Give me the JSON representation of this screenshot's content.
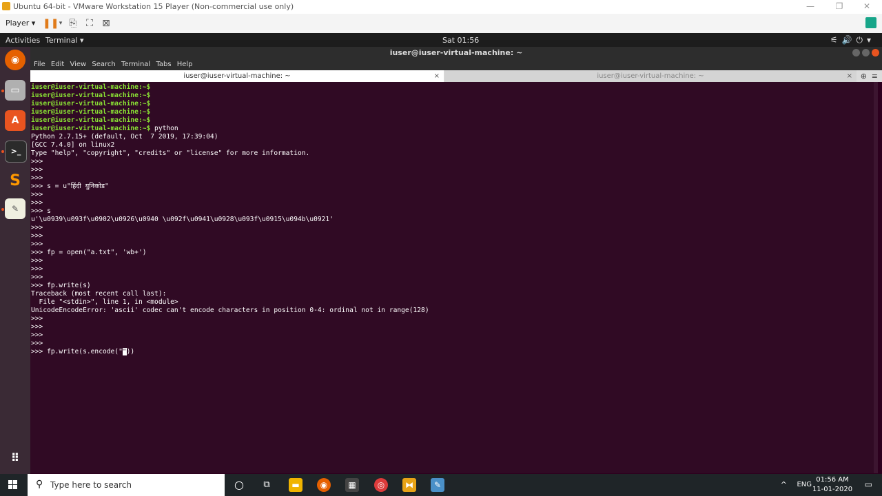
{
  "vmware": {
    "title": "Ubuntu 64-bit - VMware Workstation 15 Player (Non-commercial use only)",
    "player_menu": "Player ▾",
    "window_controls": [
      "—",
      "❐",
      "✕"
    ]
  },
  "ubuntu_topbar": {
    "activities": "Activities",
    "app_menu": "Terminal ▾",
    "clock": "Sat 01:56",
    "system_icons": "⚟🔊⏻▾"
  },
  "terminal": {
    "window_title": "iuser@iuser-virtual-machine: ~",
    "menu": [
      "File",
      "Edit",
      "View",
      "Search",
      "Terminal",
      "Tabs",
      "Help"
    ],
    "tabs": [
      {
        "label": "iuser@iuser-virtual-machine: ~",
        "active": true
      },
      {
        "label": "iuser@iuser-virtual-machine: ~",
        "active": false
      }
    ],
    "prompt": "iuser@iuser-virtual-machine:~$",
    "lines": [
      {
        "prompt": true,
        "text": ""
      },
      {
        "prompt": true,
        "text": ""
      },
      {
        "prompt": true,
        "text": ""
      },
      {
        "prompt": true,
        "text": ""
      },
      {
        "prompt": true,
        "text": ""
      },
      {
        "prompt": true,
        "text": " python"
      },
      {
        "prompt": false,
        "text": "Python 2.7.15+ (default, Oct  7 2019, 17:39:04)"
      },
      {
        "prompt": false,
        "text": "[GCC 7.4.0] on linux2"
      },
      {
        "prompt": false,
        "text": "Type \"help\", \"copyright\", \"credits\" or \"license\" for more information."
      },
      {
        "prompt": false,
        "text": ">>>"
      },
      {
        "prompt": false,
        "text": ">>>"
      },
      {
        "prompt": false,
        "text": ">>>"
      },
      {
        "prompt": false,
        "text": ">>> s = u\"हिंदी युनिकोड\""
      },
      {
        "prompt": false,
        "text": ">>>"
      },
      {
        "prompt": false,
        "text": ">>>"
      },
      {
        "prompt": false,
        "text": ">>> s"
      },
      {
        "prompt": false,
        "text": "u'\\u0939\\u093f\\u0902\\u0926\\u0940 \\u092f\\u0941\\u0928\\u093f\\u0915\\u094b\\u0921'"
      },
      {
        "prompt": false,
        "text": ">>>"
      },
      {
        "prompt": false,
        "text": ">>>"
      },
      {
        "prompt": false,
        "text": ">>>"
      },
      {
        "prompt": false,
        "text": ">>> fp = open(\"a.txt\", 'wb+')"
      },
      {
        "prompt": false,
        "text": ">>>"
      },
      {
        "prompt": false,
        "text": ">>>"
      },
      {
        "prompt": false,
        "text": ">>>"
      },
      {
        "prompt": false,
        "text": ">>> fp.write(s)"
      },
      {
        "prompt": false,
        "text": "Traceback (most recent call last):"
      },
      {
        "prompt": false,
        "text": "  File \"<stdin>\", line 1, in <module>"
      },
      {
        "prompt": false,
        "text": "UnicodeEncodeError: 'ascii' codec can't encode characters in position 0-4: ordinal not in range(128)"
      },
      {
        "prompt": false,
        "text": ">>>"
      },
      {
        "prompt": false,
        "text": ">>>"
      },
      {
        "prompt": false,
        "text": ">>>"
      },
      {
        "prompt": false,
        "text": ">>>"
      }
    ],
    "current_input_before": ">>> fp.write(s.encode(\"",
    "current_input_cursor": "\"",
    "current_input_after": "))"
  },
  "taskbar": {
    "search_placeholder": "Type here to search",
    "language": "ENG",
    "time": "01:56 AM",
    "date": "11-01-2020",
    "chevron": "^",
    "notification_icon": "▭"
  },
  "colors": {
    "terminal_bg": "#300a24",
    "prompt_green": "#8ae234",
    "ubuntu_orange": "#e95420"
  }
}
